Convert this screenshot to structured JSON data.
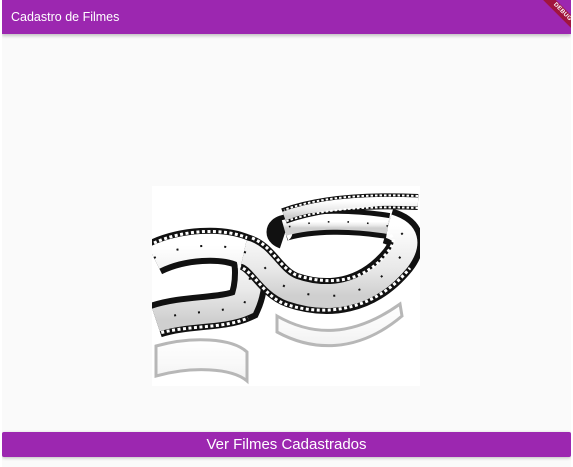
{
  "appbar": {
    "title": "Cadastro de Filmes",
    "color": "#9c27b0"
  },
  "debug_banner": {
    "label": "DEBUG",
    "color": "#a0153e"
  },
  "main": {
    "image": {
      "icon": "film-strip-image"
    }
  },
  "footer": {
    "button_label": "Ver Filmes Cadastrados",
    "button_color": "#9c27b0"
  }
}
